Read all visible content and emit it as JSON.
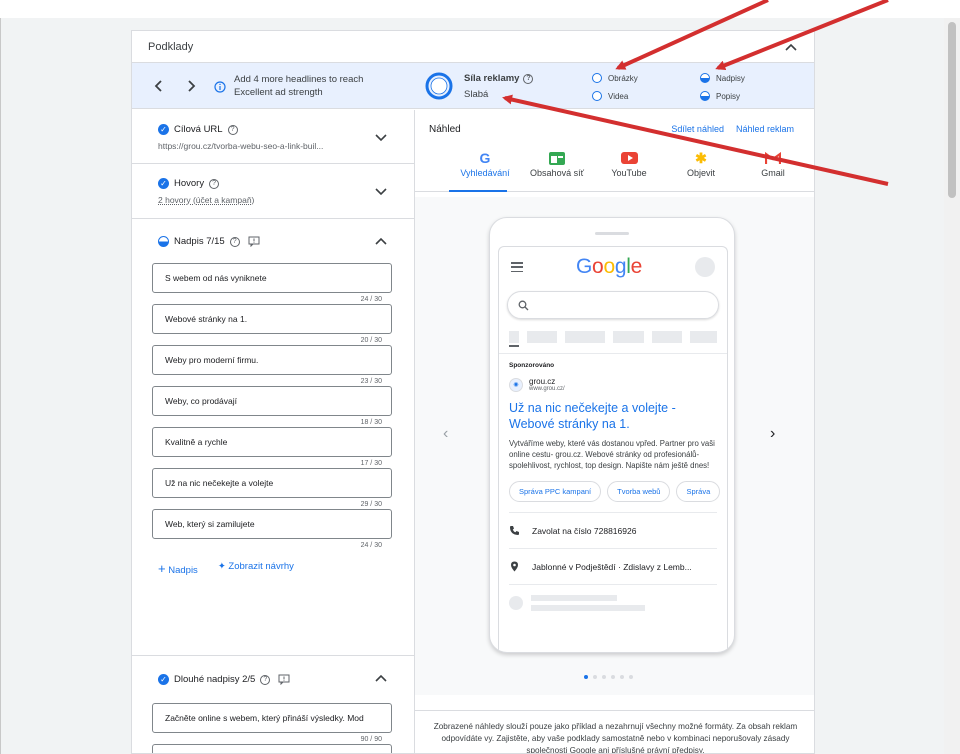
{
  "panel": {
    "title": "Podklady"
  },
  "strength": {
    "hint": "Add 4 more headlines to reach Excellent ad strength",
    "title": "Síla reklamy",
    "value": "Slabá",
    "assets": [
      "Obrázky",
      "Videa",
      "Nadpisy",
      "Popisy"
    ]
  },
  "left": {
    "url": {
      "title": "Cílová URL",
      "value": "https://grou.cz/tvorba-webu-seo-a-link-buil..."
    },
    "calls": {
      "title": "Hovory",
      "value": "2 hovory (účet a kampaň)"
    },
    "headlines": {
      "title": "Nadpis 7/15",
      "items": [
        {
          "text": "S webem od nás vyniknete",
          "count": "24 / 30"
        },
        {
          "text": "Webové stránky na 1.",
          "count": "20 / 30"
        },
        {
          "text": "Weby pro moderní firmu.",
          "count": "23 / 30"
        },
        {
          "text": "Weby, co prodávají",
          "count": "18 / 30"
        },
        {
          "text": "Kvalitně a rychle",
          "count": "17 / 30"
        },
        {
          "text": "Už na nic nečekejte a volejte",
          "count": "29 / 30"
        },
        {
          "text": "Web, který si zamilujete",
          "count": "24 / 30"
        }
      ],
      "add_label": "Nadpis",
      "suggest_label": "Zobrazit návrhy"
    },
    "long_headlines": {
      "title": "Dlouhé nadpisy 2/5",
      "items": [
        {
          "text": "Začněte online s webem, který přináší výsledky. Mod",
          "count": "90 / 90"
        }
      ]
    }
  },
  "preview": {
    "title": "Náhled",
    "share": "Sdílet náhled",
    "ad_preview": "Náhled reklam",
    "tabs": [
      "Vyhledávání",
      "Obsahová síť",
      "YouTube",
      "Objevit",
      "Gmail"
    ],
    "google": "Google",
    "sponsored": "Sponzorováno",
    "advertiser": "grou.cz",
    "advertiser_url": "www.grou.cz/",
    "ad_title": "Už na nic nečekejte a volejte - Webové stránky na 1.",
    "ad_desc": "Vytváříme weby, které vás dostanou vpřed. Partner pro vaši online cestu- grou.cz. Webové stránky od profesionálů-spolehlivost, rychlost, top design. Napište nám ještě dnes!",
    "chips": [
      "Správa PPC kampaní",
      "Tvorba webů",
      "Správa"
    ],
    "call": "Zavolat na číslo 728816926",
    "location": "Jablonné v Podještědí · Zdislavy z Lemb...",
    "disclaimer": "Zobrazené náhledy slouží pouze jako příklad a nezahrnují všechny možné formáty. Za obsah reklam odpovídáte vy. Zajistěte, aby vaše podklady samostatně nebo v kombinaci neporušovaly zásady společnosti Google ani příslušné právní předpisy."
  },
  "colors": {
    "accent": "#1a73e8",
    "arrow": "#d32f2f",
    "banner": "#e8f0fe"
  }
}
